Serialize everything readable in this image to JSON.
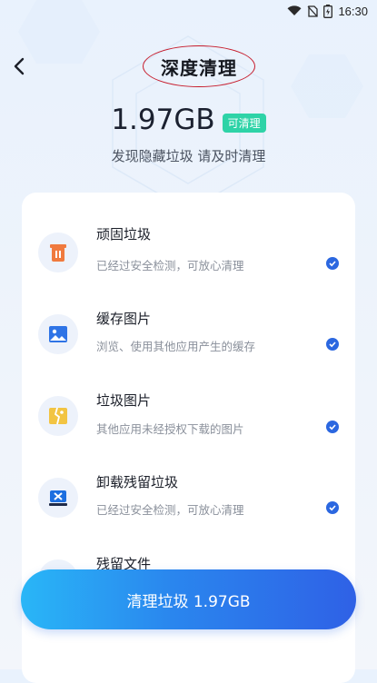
{
  "status_bar": {
    "time": "16:30"
  },
  "header": {
    "title": "深度清理"
  },
  "summary": {
    "size": "1.97GB",
    "badge": "可清理",
    "subtitle": "发现隐藏垃圾 请及时清理"
  },
  "items": [
    {
      "name": "顽固垃圾",
      "desc": "已经过安全检测，可放心清理",
      "icon": "trash-bin-icon",
      "checked": true
    },
    {
      "name": "缓存图片",
      "desc": "浏览、使用其他应用产生的缓存",
      "icon": "image-icon",
      "checked": true
    },
    {
      "name": "垃圾图片",
      "desc": "其他应用未经授权下载的图片",
      "icon": "broken-image-icon",
      "checked": true
    },
    {
      "name": "卸载残留垃圾",
      "desc": "已经过安全检测，可放心清理",
      "icon": "uninstall-box-icon",
      "checked": true
    },
    {
      "name": "残留文件",
      "icon": "file-icon"
    }
  ],
  "action": {
    "clean_label": "清理垃圾 1.97GB"
  },
  "colors": {
    "accent_blue": "#2b67e0",
    "badge_green": "#2ed3a7",
    "button_gradient_start": "#29b6f7",
    "button_gradient_end": "#2f61e6",
    "annotation_red": "#c61a2a"
  }
}
